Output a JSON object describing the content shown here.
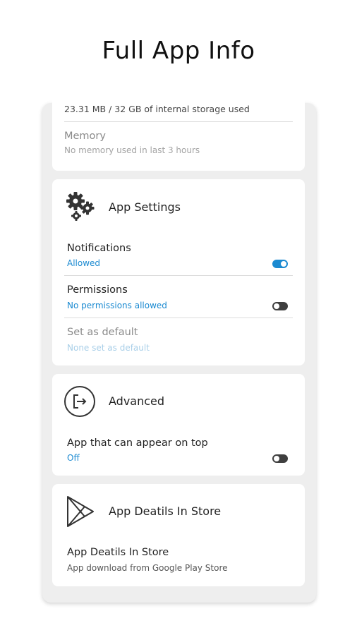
{
  "page": {
    "title": "Full App Info"
  },
  "storage": {
    "usage": "23.31 MB / 32 GB of internal storage used",
    "memory_title": "Memory",
    "memory_sub": "No memory used in last 3 hours"
  },
  "app_settings": {
    "header": "App Settings",
    "header_icon": "gears-icon",
    "notifications": {
      "title": "Notifications",
      "status": "Allowed",
      "toggle_on": true
    },
    "permissions": {
      "title": "Permissions",
      "status": "No permissions allowed",
      "toggle_on": false
    },
    "default": {
      "title": "Set as default",
      "status": "None set as default"
    }
  },
  "advanced": {
    "header": "Advanced",
    "header_icon": "exit-icon",
    "appear_on_top": {
      "title": "App that can appear on top",
      "status": "Off",
      "toggle_on": false
    }
  },
  "store": {
    "header": "App Deatils In Store",
    "header_icon": "play-store-icon",
    "row_title": "App Deatils In Store",
    "row_sub": "App download from Google Play Store"
  },
  "colors": {
    "accent": "#1b8ad1",
    "background": "#eeeeee",
    "card": "#ffffff"
  }
}
